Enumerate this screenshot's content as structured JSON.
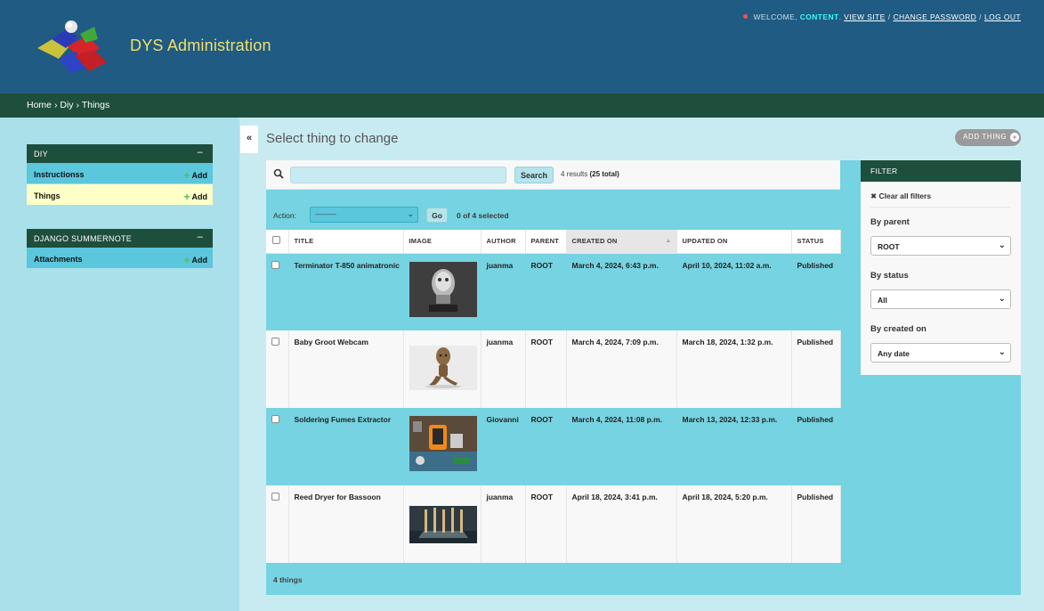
{
  "header": {
    "site_name": "DYS Administration",
    "welcome": "Welcome,",
    "username": "content",
    "view_site": "View site",
    "change_password": "Change password",
    "log_out": "Log out",
    "sep": "/"
  },
  "breadcrumbs": {
    "home": "Home",
    "sep": "›",
    "app": "Diy",
    "current": "Things"
  },
  "sidebar": {
    "modules": [
      {
        "caption": "DIY",
        "collapse": "–",
        "items": [
          {
            "label": "Instructionss",
            "add": "Add"
          },
          {
            "label": "Things",
            "add": "Add"
          }
        ]
      },
      {
        "caption": "DJANGO SUMMERNOTE",
        "collapse": "–",
        "items": [
          {
            "label": "Attachments",
            "add": "Add"
          }
        ]
      }
    ]
  },
  "toggle": "«",
  "content": {
    "title": "Select thing to change",
    "add_button": "ADD THING",
    "search": {
      "button": "Search",
      "results": "4 results",
      "total": "(25 total)"
    },
    "actions": {
      "label": "Action:",
      "select_value": "---------",
      "go": "Go",
      "selected": "0 of 4 selected"
    },
    "columns": [
      "TITLE",
      "IMAGE",
      "AUTHOR",
      "PARENT",
      "CREATED ON",
      "UPDATED ON",
      "STATUS"
    ],
    "rows": [
      {
        "title": "Terminator T-850 animatronic",
        "author": "juanma",
        "parent": "ROOT",
        "created": "March 4, 2024, 6:43 p.m.",
        "updated": "April 10, 2024, 11:02 a.m.",
        "status": "Published"
      },
      {
        "title": "Baby Groot Webcam",
        "author": "juanma",
        "parent": "ROOT",
        "created": "March 4, 2024, 7:09 p.m.",
        "updated": "March 18, 2024, 1:32 p.m.",
        "status": "Published"
      },
      {
        "title": "Soldering Fumes Extractor",
        "author": "Giovanni",
        "parent": "ROOT",
        "created": "March 4, 2024, 11:08 p.m.",
        "updated": "March 13, 2024, 12:33 p.m.",
        "status": "Published"
      },
      {
        "title": "Reed Dryer for Bassoon",
        "author": "juanma",
        "parent": "ROOT",
        "created": "April 18, 2024, 3:41 p.m.",
        "updated": "April 18, 2024, 5:20 p.m.",
        "status": "Published"
      }
    ],
    "footer": "4 things"
  },
  "filter": {
    "title": "FILTER",
    "clear": "✖ Clear all filters",
    "by_parent": {
      "label": "By parent",
      "value": "ROOT"
    },
    "by_status": {
      "label": "By status",
      "value": "All"
    },
    "by_created": {
      "label": "By created on",
      "value": "Any date"
    }
  }
}
